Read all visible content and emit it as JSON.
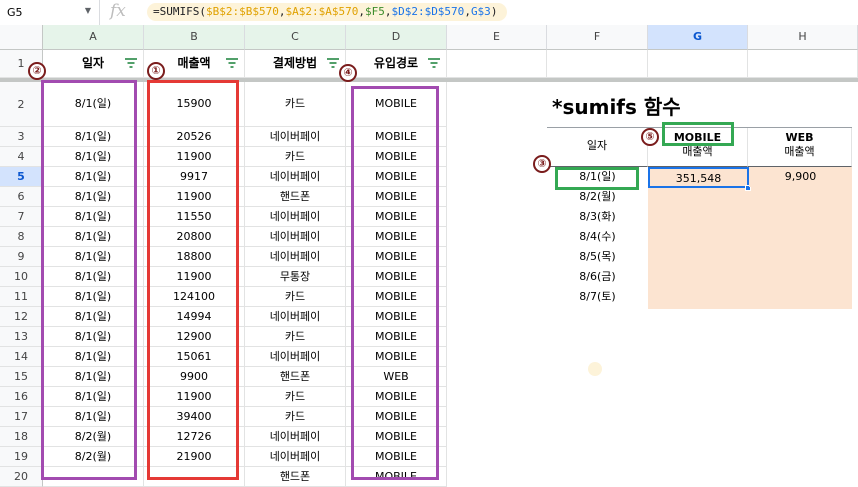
{
  "name_box": "G5",
  "fx_symbol": "fx",
  "formula_tokens": [
    {
      "t": "=SUMIFS(",
      "c": "tk0"
    },
    {
      "t": "$B$2:$B$570",
      "c": "tk1"
    },
    {
      "t": ",",
      "c": "tk0"
    },
    {
      "t": "$A$2:$A$570",
      "c": "tk2"
    },
    {
      "t": ",",
      "c": "tk0"
    },
    {
      "t": "$F5",
      "c": "tk3"
    },
    {
      "t": ",",
      "c": "tk0"
    },
    {
      "t": "$D$2:$D$570",
      "c": "tk4"
    },
    {
      "t": ",",
      "c": "tk0"
    },
    {
      "t": "G$3",
      "c": "tk5"
    },
    {
      "t": ")",
      "c": "tk0"
    }
  ],
  "columns": [
    "A",
    "B",
    "C",
    "D",
    "E",
    "F",
    "G",
    "H"
  ],
  "row_numbers": [
    "1",
    "2",
    "3",
    "4",
    "5",
    "6",
    "7",
    "8",
    "9",
    "10",
    "11",
    "12",
    "13",
    "14",
    "15",
    "16",
    "17",
    "18",
    "19",
    "20"
  ],
  "headers": {
    "date": "일자",
    "sales": "매출액",
    "payment": "결제방법",
    "channel": "유입경로"
  },
  "rows": [
    [
      "8/1(일)",
      "15900",
      "카드",
      "MOBILE"
    ],
    [
      "8/1(일)",
      "20526",
      "네이버페이",
      "MOBILE"
    ],
    [
      "8/1(일)",
      "11900",
      "카드",
      "MOBILE"
    ],
    [
      "8/1(일)",
      "9917",
      "네이버페이",
      "MOBILE"
    ],
    [
      "8/1(일)",
      "11900",
      "핸드폰",
      "MOBILE"
    ],
    [
      "8/1(일)",
      "11550",
      "네이버페이",
      "MOBILE"
    ],
    [
      "8/1(일)",
      "20800",
      "네이버페이",
      "MOBILE"
    ],
    [
      "8/1(일)",
      "18800",
      "네이버페이",
      "MOBILE"
    ],
    [
      "8/1(일)",
      "11900",
      "무통장",
      "MOBILE"
    ],
    [
      "8/1(일)",
      "124100",
      "카드",
      "MOBILE"
    ],
    [
      "8/1(일)",
      "14994",
      "네이버페이",
      "MOBILE"
    ],
    [
      "8/1(일)",
      "12900",
      "카드",
      "MOBILE"
    ],
    [
      "8/1(일)",
      "15061",
      "네이버페이",
      "MOBILE"
    ],
    [
      "8/1(일)",
      "9900",
      "핸드폰",
      "WEB"
    ],
    [
      "8/1(일)",
      "11900",
      "카드",
      "MOBILE"
    ],
    [
      "8/1(일)",
      "39400",
      "카드",
      "MOBILE"
    ],
    [
      "8/2(월)",
      "12726",
      "네이버페이",
      "MOBILE"
    ],
    [
      "8/2(월)",
      "21900",
      "네이버페이",
      "MOBILE"
    ],
    [
      "",
      "",
      "핸드폰",
      "MOBILE"
    ]
  ],
  "summary": {
    "title": "*sumifs 함수",
    "date_header": "일자",
    "mobile_header": "MOBILE",
    "web_header": "WEB",
    "sales_label": "매출액",
    "dates": [
      "8/1(일)",
      "8/2(월)",
      "8/3(화)",
      "8/4(수)",
      "8/5(목)",
      "8/6(금)",
      "8/7(토)"
    ],
    "mobile_first": "351,548",
    "web_first": "9,900"
  },
  "markers": [
    "①",
    "②",
    "③",
    "④",
    "⑤"
  ],
  "colors": {
    "red_box": "#e53935",
    "purple_box": "#a24bb0",
    "green_box": "#34a853",
    "peach": "#fce4d1",
    "selection": "#1a73e8"
  }
}
